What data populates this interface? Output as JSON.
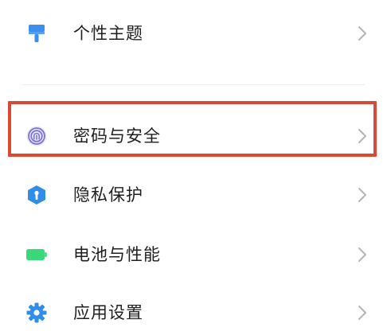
{
  "settings": {
    "items": [
      {
        "label": "个性主题",
        "icon": "theme-brush-icon",
        "icon_color": "#3b8ff0"
      },
      {
        "label": "密码与安全",
        "icon": "fingerprint-icon",
        "icon_color": "#7b74d6"
      },
      {
        "label": "隐私保护",
        "icon": "privacy-shield-icon",
        "icon_color": "#2f8fe8"
      },
      {
        "label": "电池与性能",
        "icon": "battery-icon",
        "icon_color": "#39d97a"
      },
      {
        "label": "应用设置",
        "icon": "gear-icon",
        "icon_color": "#2f8fe8"
      }
    ],
    "highlighted_item": "密码与安全",
    "highlight_color": "#d84a34",
    "chevron_color": "#b5b5b5"
  }
}
